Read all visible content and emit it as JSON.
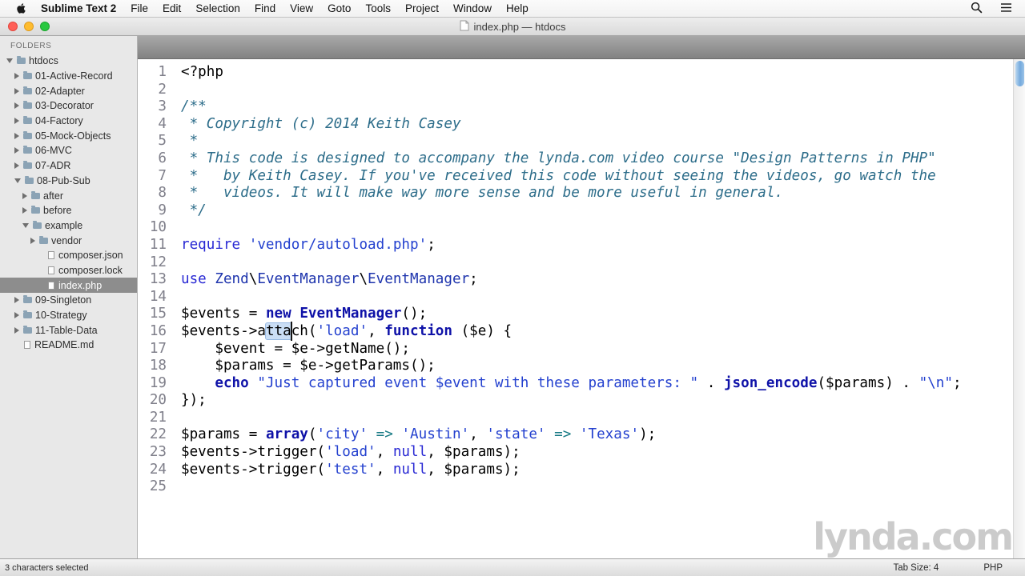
{
  "menu_bar": {
    "items": [
      "Sublime Text 2",
      "File",
      "Edit",
      "Selection",
      "Find",
      "View",
      "Goto",
      "Tools",
      "Project",
      "Window",
      "Help"
    ],
    "right_icons": [
      "spotlight-search",
      "notification-list"
    ]
  },
  "title_bar": {
    "title": "index.php — htdocs"
  },
  "sidebar": {
    "header": "FOLDERS",
    "items": [
      {
        "label": "htdocs",
        "level": 0,
        "type": "folder",
        "expanded": true,
        "selected": false
      },
      {
        "label": "01-Active-Record",
        "level": 1,
        "type": "folder",
        "expanded": false,
        "selected": false
      },
      {
        "label": "02-Adapter",
        "level": 1,
        "type": "folder",
        "expanded": false,
        "selected": false
      },
      {
        "label": "03-Decorator",
        "level": 1,
        "type": "folder",
        "expanded": false,
        "selected": false
      },
      {
        "label": "04-Factory",
        "level": 1,
        "type": "folder",
        "expanded": false,
        "selected": false
      },
      {
        "label": "05-Mock-Objects",
        "level": 1,
        "type": "folder",
        "expanded": false,
        "selected": false
      },
      {
        "label": "06-MVC",
        "level": 1,
        "type": "folder",
        "expanded": false,
        "selected": false
      },
      {
        "label": "07-ADR",
        "level": 1,
        "type": "folder",
        "expanded": false,
        "selected": false
      },
      {
        "label": "08-Pub-Sub",
        "level": 1,
        "type": "folder",
        "expanded": true,
        "selected": false
      },
      {
        "label": "after",
        "level": 2,
        "type": "folder",
        "expanded": false,
        "selected": false
      },
      {
        "label": "before",
        "level": 2,
        "type": "folder",
        "expanded": false,
        "selected": false
      },
      {
        "label": "example",
        "level": 2,
        "type": "folder",
        "expanded": true,
        "selected": false
      },
      {
        "label": "vendor",
        "level": 3,
        "type": "folder",
        "expanded": false,
        "selected": false
      },
      {
        "label": "composer.json",
        "level": 4,
        "type": "file",
        "expanded": false,
        "selected": false
      },
      {
        "label": "composer.lock",
        "level": 4,
        "type": "file",
        "expanded": false,
        "selected": false
      },
      {
        "label": "index.php",
        "level": 4,
        "type": "file",
        "expanded": false,
        "selected": true
      },
      {
        "label": "09-Singleton",
        "level": 1,
        "type": "folder",
        "expanded": false,
        "selected": false
      },
      {
        "label": "10-Strategy",
        "level": 1,
        "type": "folder",
        "expanded": false,
        "selected": false
      },
      {
        "label": "11-Table-Data",
        "level": 1,
        "type": "folder",
        "expanded": false,
        "selected": false
      },
      {
        "label": "README.md",
        "level": 1,
        "type": "file",
        "expanded": false,
        "selected": false
      }
    ]
  },
  "editor": {
    "lines": [
      {
        "num": 1,
        "tokens": [
          [
            "p",
            "<?php"
          ]
        ]
      },
      {
        "num": 2,
        "tokens": []
      },
      {
        "num": 3,
        "tokens": [
          [
            "c",
            "/**"
          ]
        ]
      },
      {
        "num": 4,
        "tokens": [
          [
            "c",
            " * Copyright (c) 2014 Keith Casey"
          ]
        ]
      },
      {
        "num": 5,
        "tokens": [
          [
            "c",
            " *"
          ]
        ]
      },
      {
        "num": 6,
        "tokens": [
          [
            "c",
            " * This code is designed to accompany the lynda.com video course \"Design Patterns in PHP\""
          ]
        ]
      },
      {
        "num": 7,
        "tokens": [
          [
            "c",
            " *   by Keith Casey. If you've received this code without seeing the videos, go watch the"
          ]
        ]
      },
      {
        "num": 8,
        "tokens": [
          [
            "c",
            " *   videos. It will make way more sense and be more useful in general."
          ]
        ]
      },
      {
        "num": 9,
        "tokens": [
          [
            "c",
            " */"
          ]
        ]
      },
      {
        "num": 10,
        "tokens": []
      },
      {
        "num": 11,
        "tokens": [
          [
            "k",
            "require"
          ],
          [
            "p",
            " "
          ],
          [
            "s",
            "'vendor/autoload.php'"
          ],
          [
            "p",
            ";"
          ]
        ]
      },
      {
        "num": 12,
        "tokens": []
      },
      {
        "num": 13,
        "tokens": [
          [
            "k",
            "use"
          ],
          [
            "p",
            " "
          ],
          [
            "n",
            "Zend"
          ],
          [
            "p",
            "\\"
          ],
          [
            "n",
            "EventManager"
          ],
          [
            "p",
            "\\"
          ],
          [
            "n",
            "EventManager"
          ],
          [
            "p",
            ";"
          ]
        ]
      },
      {
        "num": 14,
        "tokens": []
      },
      {
        "num": 15,
        "tokens": [
          [
            "p",
            "$events = "
          ],
          [
            "b",
            "new"
          ],
          [
            "p",
            " "
          ],
          [
            "b",
            "EventManager"
          ],
          [
            "p",
            "();"
          ]
        ]
      },
      {
        "num": 16,
        "tokens": [
          [
            "p",
            "$events->a"
          ],
          [
            "sel",
            "tta"
          ],
          [
            "p",
            "ch("
          ],
          [
            "s",
            "'load'"
          ],
          [
            "p",
            ", "
          ],
          [
            "b",
            "function"
          ],
          [
            "p",
            " ($e) {"
          ]
        ]
      },
      {
        "num": 17,
        "tokens": [
          [
            "p",
            "    $event = $e->getName();"
          ]
        ]
      },
      {
        "num": 18,
        "tokens": [
          [
            "p",
            "    $params = $e->getParams();"
          ]
        ]
      },
      {
        "num": 19,
        "tokens": [
          [
            "p",
            "    "
          ],
          [
            "b",
            "echo"
          ],
          [
            "p",
            " "
          ],
          [
            "s",
            "\"Just captured event $event with these parameters: \""
          ],
          [
            "p",
            " . "
          ],
          [
            "b",
            "json_encode"
          ],
          [
            "p",
            "($params) . "
          ],
          [
            "s",
            "\"\\n\""
          ],
          [
            "p",
            ";"
          ]
        ]
      },
      {
        "num": 20,
        "tokens": [
          [
            "p",
            "});"
          ]
        ]
      },
      {
        "num": 21,
        "tokens": []
      },
      {
        "num": 22,
        "tokens": [
          [
            "p",
            "$params = "
          ],
          [
            "b",
            "array"
          ],
          [
            "p",
            "("
          ],
          [
            "s",
            "'city'"
          ],
          [
            "p",
            " "
          ],
          [
            "o",
            "=>"
          ],
          [
            "p",
            " "
          ],
          [
            "s",
            "'Austin'"
          ],
          [
            "p",
            ", "
          ],
          [
            "s",
            "'state'"
          ],
          [
            "p",
            " "
          ],
          [
            "o",
            "=>"
          ],
          [
            "p",
            " "
          ],
          [
            "s",
            "'Texas'"
          ],
          [
            "p",
            ");"
          ]
        ]
      },
      {
        "num": 23,
        "tokens": [
          [
            "p",
            "$events->trigger("
          ],
          [
            "s",
            "'load'"
          ],
          [
            "p",
            ", "
          ],
          [
            "k",
            "null"
          ],
          [
            "p",
            ", $params);"
          ]
        ]
      },
      {
        "num": 24,
        "tokens": [
          [
            "p",
            "$events->trigger("
          ],
          [
            "s",
            "'test'"
          ],
          [
            "p",
            ", "
          ],
          [
            "k",
            "null"
          ],
          [
            "p",
            ", $params);"
          ]
        ]
      },
      {
        "num": 25,
        "tokens": []
      }
    ]
  },
  "status_bar": {
    "left": "3 characters selected",
    "tab_size": "Tab Size: 4",
    "syntax": "PHP"
  },
  "watermark": "lynda.com",
  "colors": {
    "traffic_red": "#ff5f57",
    "traffic_yellow": "#febc2e",
    "traffic_green": "#28c840",
    "text_selection": "#cadef5",
    "sidebar_selected": "#8d8d8d",
    "comment": "#2d6d8a",
    "keyword": "#2a2ad4",
    "string": "#2441cf"
  }
}
